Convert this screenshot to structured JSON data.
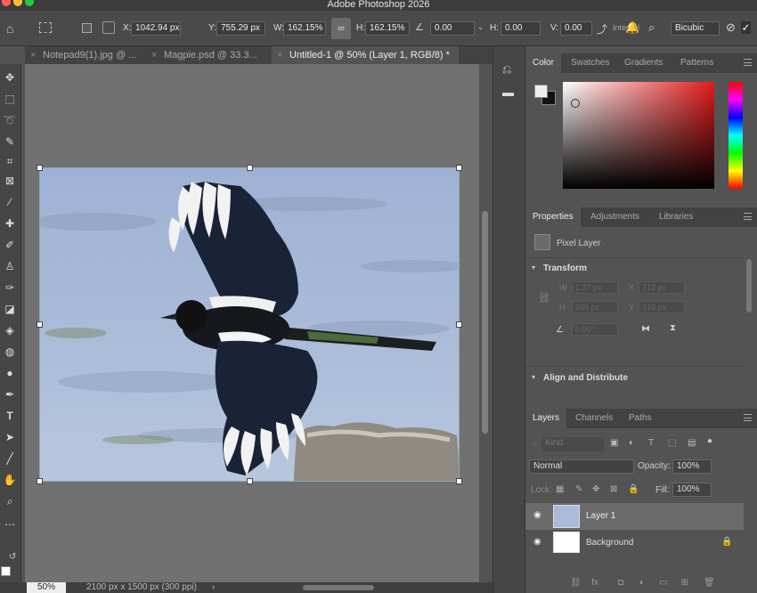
{
  "app_title": "Adobe Photoshop 2026",
  "colors": {
    "accent": "#4a90d9",
    "bg": "#535353",
    "selected_layer": "#6b6b6b"
  },
  "options_bar": {
    "x_label": "X:",
    "x_value": "1042.94 px",
    "y_label": "Y:",
    "y_value": "755.29 px",
    "w_label": "W:",
    "w_value": "162.15%",
    "h_label": "H:",
    "h_value": "162.15%",
    "angle_value": "0.00",
    "hskew_label": "H:",
    "hskew_value": "0.00",
    "vskew_label": "V:",
    "vskew_value": "0.00",
    "interp_label": "Interpol",
    "interp_value": "Bicubic"
  },
  "doc_tabs": [
    {
      "label": "Notepad9(1).jpg @ ..."
    },
    {
      "label": "Magpie.psd @ 33.3..."
    },
    {
      "label": "Untitled-1 @ 50% (Layer 1, RGB/8) *"
    }
  ],
  "status": {
    "zoom": "50%",
    "doc_info": "2100 px x 1500 px (300 ppi)"
  },
  "color_panel": {
    "tabs": [
      "Color",
      "Swatches",
      "Gradients",
      "Patterns"
    ]
  },
  "properties_panel": {
    "tabs": [
      "Properties",
      "Adjustments",
      "Libraries"
    ],
    "layer_type": "Pixel Layer",
    "transform_label": "Transform",
    "align_label": "Align and Distribute",
    "w_label": "W",
    "w_value": "1.37 px",
    "x_label": "X",
    "x_value": "312 px",
    "h_label": "H",
    "h_value": "945 px",
    "y_label": "Y",
    "y_value": "310 px",
    "angle_value": "0.00°"
  },
  "layers_panel": {
    "tabs": [
      "Layers",
      "Channels",
      "Paths"
    ],
    "filter_placeholder": "Kind",
    "blend_mode": "Normal",
    "opacity_label": "Opacity:",
    "opacity_value": "100%",
    "lock_label": "Lock:",
    "fill_label": "Fill:",
    "fill_value": "100%",
    "layers": [
      {
        "name": "Layer 1",
        "selected": true
      },
      {
        "name": "Background",
        "selected": false
      }
    ]
  }
}
